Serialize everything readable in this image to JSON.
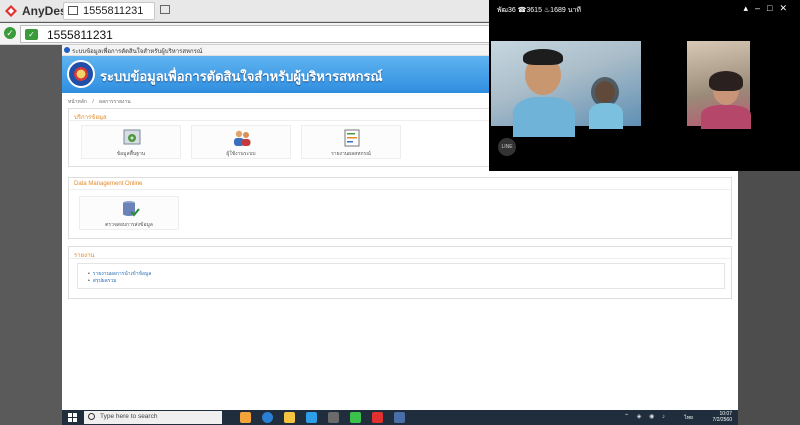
{
  "anydesk": {
    "app_name": "AnyDesk",
    "tab_label": "1555811231",
    "address": "1555811231"
  },
  "browser": {
    "tab_title": "ระบบข้อมูลเพื่อการตัดสินใจสำหรับผู้บริหารสหกรณ์"
  },
  "site": {
    "title": "ระบบข้อมูลเพื่อการตัดสินใจสำหรับผู้บริหารสหกรณ์",
    "breadcrumb": [
      "หน้าหลัก",
      "ผลการรายงาน"
    ]
  },
  "services": {
    "header": "บริการข้อมูล",
    "tiles": [
      {
        "label": "ข้อมูลพื้นฐาน",
        "icon": "standards-icon"
      },
      {
        "label": "ผู้ใช้งานระบบ",
        "icon": "users-icon"
      },
      {
        "label": "รายงานผลสหกรณ์",
        "icon": "report-icon"
      }
    ]
  },
  "data_management": {
    "header": "Data Management Online",
    "tiles": [
      {
        "label": "ตรวจสอบการส่งข้อมูล",
        "icon": "database-check-icon"
      }
    ]
  },
  "reports": {
    "header": "รายงาน",
    "items": [
      "รายงานผลการนำเข้าข้อมูล",
      "สรุปผลรวม"
    ]
  },
  "video_call": {
    "status": "พัฒ36 ☎3615 ♨1689 นาที",
    "controls": [
      "pin-icon",
      "minimize-icon",
      "maximize-icon",
      "close-icon"
    ],
    "app_badge": "LINE"
  },
  "taskbar": {
    "search_placeholder": "Type here to search",
    "language": "ไทย",
    "time": "10:07",
    "date": "7/2/2560",
    "apps": [
      "task-view-icon",
      "edge-icon",
      "file-explorer-icon",
      "ie-icon",
      "store-icon",
      "line-app-icon",
      "anydesk-app-icon",
      "app-icon"
    ]
  },
  "colors": {
    "banner": "#2f8ee0",
    "section_header": "#e08a2a",
    "link": "#2a6fb8",
    "taskbar": "#1f2d3d",
    "anydesk_red": "#e0312f",
    "connected_green": "#3a9b3a"
  }
}
